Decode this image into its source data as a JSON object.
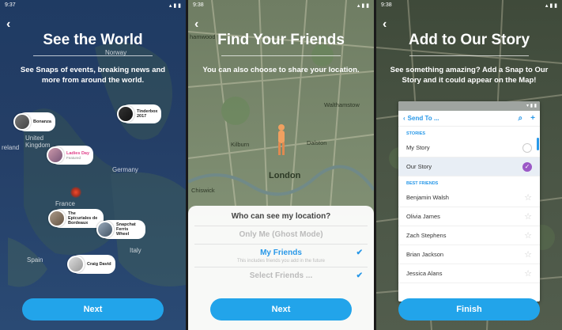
{
  "panel1": {
    "status_time": "9:37",
    "title": "See the World",
    "subtitle": "See Snaps of events, breaking news and more from around the world.",
    "map_labels": [
      "Norway",
      "reland",
      "United Kingdom",
      "Germany",
      "France",
      "Spain",
      "Italy"
    ],
    "pins": [
      {
        "name": "Bonanza",
        "sub": ""
      },
      {
        "name": "Tinderbox 2017",
        "sub": ""
      },
      {
        "name": "Ladies Day",
        "sub": "Featured"
      },
      {
        "name": "The Epicuriales de Bordeaux",
        "sub": ""
      },
      {
        "name": "Snapchat Ferris Wheel",
        "sub": ""
      },
      {
        "name": "Craig David",
        "sub": ""
      }
    ],
    "button": "Next"
  },
  "panel2": {
    "status_time": "9:38",
    "title": "Find Your Friends",
    "subtitle": "You can also choose to share your location.",
    "map_labels": [
      "hamwood",
      "Walthamstow",
      "Kilburn",
      "Dalston",
      "London",
      "Chiswick"
    ],
    "sheet": {
      "question": "Who can see my location?",
      "ghost": "Only Me (Ghost Mode)",
      "friends": "My Friends",
      "friends_note": "This includes friends you add in the future",
      "select": "Select Friends ..."
    },
    "button": "Next"
  },
  "panel3": {
    "status_time": "9:38",
    "title": "Add to Our Story",
    "subtitle": "See something amazing? Add a Snap to Our Story and it could appear on the Map!",
    "card": {
      "header": "Send To ...",
      "stories_label": "STORIES",
      "stories": [
        "My Story",
        "Our Story"
      ],
      "best_label": "BEST FRIENDS",
      "friends": [
        "Benjamin Walsh",
        "Olivia James",
        "Zach Stephens",
        "Brian Jackson",
        "Jessica Alans"
      ]
    },
    "button": "Finish"
  },
  "colors": {
    "accent": "#22a4ea",
    "purple": "#9b59c6"
  }
}
